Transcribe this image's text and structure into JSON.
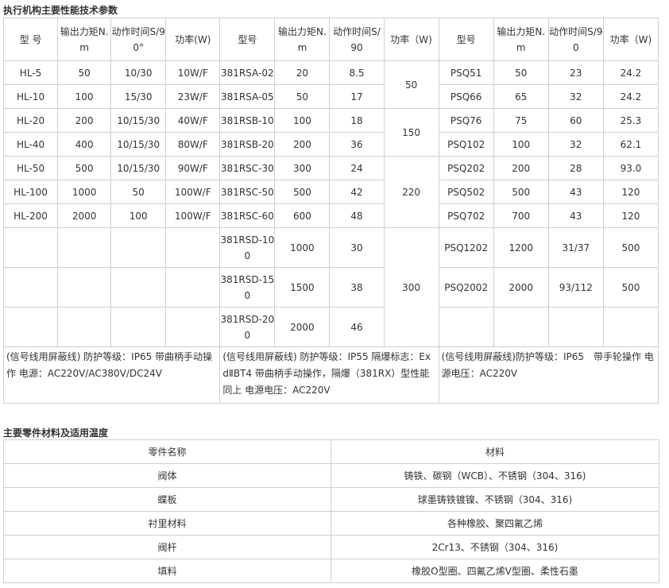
{
  "section1_title": "执行机构主要性能技术参数",
  "spec_headers": {
    "hl_model": "型 号",
    "hl_torque": "输出力矩N.m",
    "hl_time": "动作时间S/90°",
    "hl_power": "功率(W)",
    "rs_model": "型号",
    "rs_torque": "输出力矩N.m",
    "rs_time": "动作时间S/90",
    "rs_power": "功率（W)",
    "psq_model": "型号",
    "psq_torque": "输出力矩N.m",
    "psq_time": "动作时间S/90",
    "psq_power": "功率（W)"
  },
  "hl_rows": [
    {
      "model": "HL-5",
      "torque": "50",
      "time": "10/30",
      "power": "10W/F"
    },
    {
      "model": "HL-10",
      "torque": "100",
      "time": "15/30",
      "power": "23W/F"
    },
    {
      "model": "HL-20",
      "torque": "200",
      "time": "10/15/30",
      "power": "40W/F"
    },
    {
      "model": "HL-40",
      "torque": "400",
      "time": "10/15/30",
      "power": "80W/F"
    },
    {
      "model": "HL-50",
      "torque": "500",
      "time": "10/15/30",
      "power": "90W/F"
    },
    {
      "model": "HL-100",
      "torque": "1000",
      "time": "50",
      "power": "100W/F"
    },
    {
      "model": "HL-200",
      "torque": "2000",
      "time": "100",
      "power": "100W/F"
    }
  ],
  "rs_rows": [
    {
      "model": "381RSA-02",
      "torque": "20",
      "time": "8.5"
    },
    {
      "model": "381RSA-05",
      "torque": "50",
      "time": "17"
    },
    {
      "model": "381RSB-10",
      "torque": "100",
      "time": "18"
    },
    {
      "model": "381RSB-20",
      "torque": "200",
      "time": "36"
    },
    {
      "model": "381RSC-30",
      "torque": "300",
      "time": "24"
    },
    {
      "model": "381RSC-50",
      "torque": "500",
      "time": "42"
    },
    {
      "model": "381RSC-60",
      "torque": "600",
      "time": "48"
    },
    {
      "model": "381RSD-100",
      "torque": "1000",
      "time": "30"
    },
    {
      "model": "381RSD-150",
      "torque": "1500",
      "time": "38"
    },
    {
      "model": "381RSD-200",
      "torque": "2000",
      "time": "46"
    }
  ],
  "rs_powers": [
    "50",
    "150",
    "220",
    "300"
  ],
  "psq_rows": [
    {
      "model": "PSQ51",
      "torque": "50",
      "time": "23",
      "power": "24.2"
    },
    {
      "model": "PSQ66",
      "torque": "65",
      "time": "32",
      "power": "24.2"
    },
    {
      "model": "PSQ76",
      "torque": "75",
      "time": "60",
      "power": "25.3"
    },
    {
      "model": "PSQ102",
      "torque": "100",
      "time": "32",
      "power": "62.1"
    },
    {
      "model": "PSQ202",
      "torque": "200",
      "time": "28",
      "power": "93.0"
    },
    {
      "model": "PSQ502",
      "torque": "500",
      "time": "43",
      "power": "120"
    },
    {
      "model": "PSQ702",
      "torque": "700",
      "time": "43",
      "power": "120"
    },
    {
      "model": "PSQ1202",
      "torque": "1200",
      "time": "31/37",
      "power": "500"
    },
    {
      "model": "PSQ2002",
      "torque": "2000",
      "time": "93/112",
      "power": "500"
    }
  ],
  "notes": {
    "hl": "(信号线用屏蔽线) 防护等级：IP65 带曲柄手动操作 电源：AC220V/AC380V/DC24V",
    "rs": "(信号线用屏蔽线) 防护等级：IP55 隔爆标志：ExdⅡBT4 带曲柄手动操作，隔爆（381RX）型性能同上 电源电压：AC220V",
    "psq": "(信号线用屏蔽线)防护等级：IP65　带手轮操作 电源电压：AC220V"
  },
  "section2_title": "主要零件材料及适用温度",
  "parts_headers": {
    "name": "零件名称",
    "material": "材料"
  },
  "parts_rows": [
    {
      "name": "阀体",
      "material": "铸铁、碳钢（WCB）、不锈钢（304、316)"
    },
    {
      "name": "蝶板",
      "material": "球墨铸铁镀镍、不锈钢（304、316)"
    },
    {
      "name": "衬里材料",
      "material": "各种橡胶、聚四氟乙烯"
    },
    {
      "name": "阀杆",
      "material": "2Cr13、不锈钢（304、316)"
    },
    {
      "name": "填料",
      "material": "橡胶O型圈、四氟乙烯V型圈、柔性石墨"
    }
  ]
}
